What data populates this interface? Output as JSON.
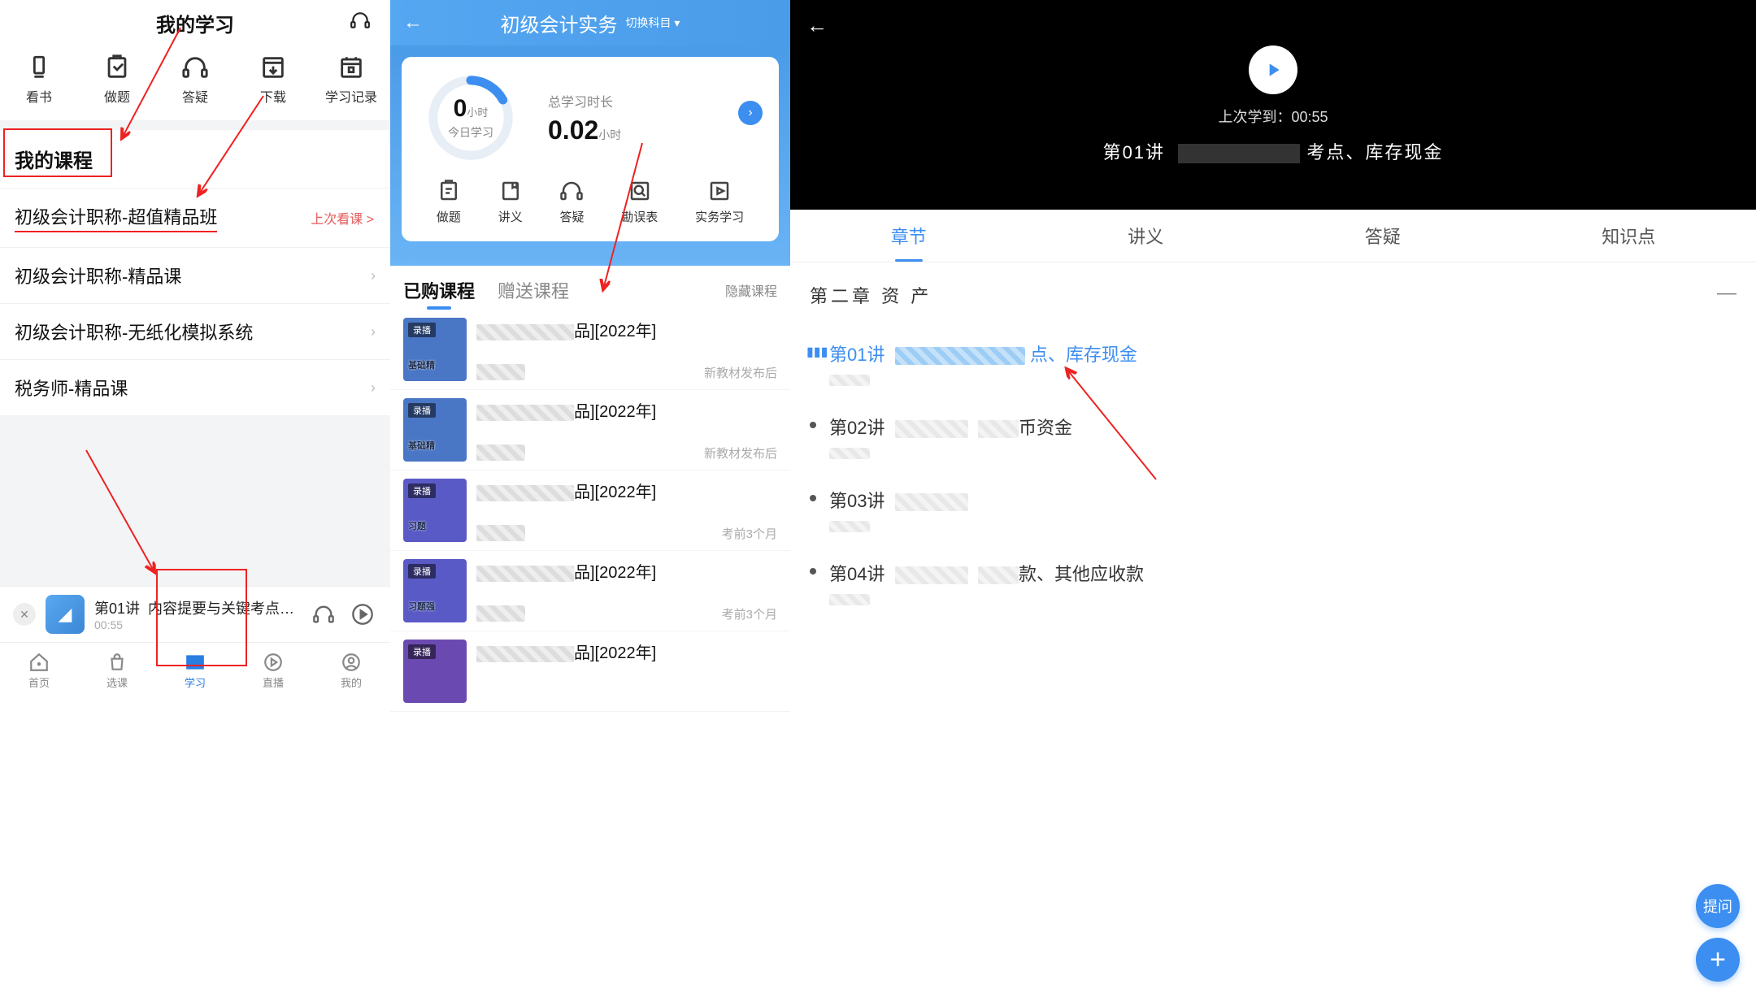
{
  "phone1": {
    "header_title": "我的学习",
    "toolbar": [
      {
        "icon": "book",
        "label": "看书"
      },
      {
        "icon": "pencil",
        "label": "做题"
      },
      {
        "icon": "headset",
        "label": "答疑"
      },
      {
        "icon": "download",
        "label": "下载"
      },
      {
        "icon": "calendar",
        "label": "学习记录"
      }
    ],
    "section_title": "我的课程",
    "courses": [
      {
        "title": "初级会计职称-超值精品班",
        "badge": "上次看课 >"
      },
      {
        "title": "初级会计职称-精品课"
      },
      {
        "title": "初级会计职称-无纸化模拟系统"
      },
      {
        "title": "税务师-精品课"
      }
    ],
    "player": {
      "prefix": "第01讲",
      "title": "内容提要与关键考点…",
      "time": "00:55"
    },
    "tabbar": [
      {
        "icon": "home",
        "label": "首页"
      },
      {
        "icon": "bag",
        "label": "选课"
      },
      {
        "icon": "bookopen",
        "label": "学习",
        "active": true
      },
      {
        "icon": "play",
        "label": "直播"
      },
      {
        "icon": "user",
        "label": "我的"
      }
    ]
  },
  "phone2": {
    "header_title": "初级会计实务",
    "switch_label": "切换科目 ▾",
    "stats": {
      "today_num": "0",
      "today_unit": "小时",
      "today_label": "今日学习",
      "total_label": "总学习时长",
      "total_num": "0.02",
      "total_unit": "小时"
    },
    "actions": [
      {
        "icon": "pencil",
        "label": "做题"
      },
      {
        "icon": "note",
        "label": "讲义"
      },
      {
        "icon": "headset",
        "label": "答疑"
      },
      {
        "icon": "search",
        "label": "勘误表"
      },
      {
        "icon": "play",
        "label": "实务学习"
      }
    ],
    "tabs": {
      "purchased": "已购课程",
      "gift": "赠送课程",
      "hide": "隐藏课程"
    },
    "courses": [
      {
        "suffix": "品][2022年]",
        "sub": "新教材发布后",
        "badge": "录播",
        "thumb_txt": "基础精"
      },
      {
        "suffix": "品][2022年]",
        "sub": "新教材发布后",
        "badge": "录播",
        "thumb_txt": "基础精"
      },
      {
        "suffix": "品][2022年]",
        "sub": "考前3个月",
        "badge": "录播",
        "thumb_txt": "习题"
      },
      {
        "suffix": "品][2022年]",
        "sub": "考前3个月",
        "badge": "录播",
        "thumb_txt": "习题强"
      },
      {
        "suffix": "品][2022年]",
        "sub": "",
        "badge": "录播",
        "thumb_txt": ""
      }
    ]
  },
  "phone3": {
    "last_pos": "上次学到：00:55",
    "video_title_prefix": "第01讲",
    "video_title_suffix": "考点、库存现金",
    "tabs": [
      "章节",
      "讲义",
      "答疑",
      "知识点"
    ],
    "chapter_title": "第二章 资 产",
    "lectures": [
      {
        "num": "第01讲",
        "suffix": "点、库存现金",
        "active": true
      },
      {
        "num": "第02讲",
        "suffix": "币资金"
      },
      {
        "num": "第03讲",
        "suffix": ""
      },
      {
        "num": "第04讲",
        "suffix": "款、其他应收款"
      }
    ],
    "fab_ask": "提问"
  }
}
